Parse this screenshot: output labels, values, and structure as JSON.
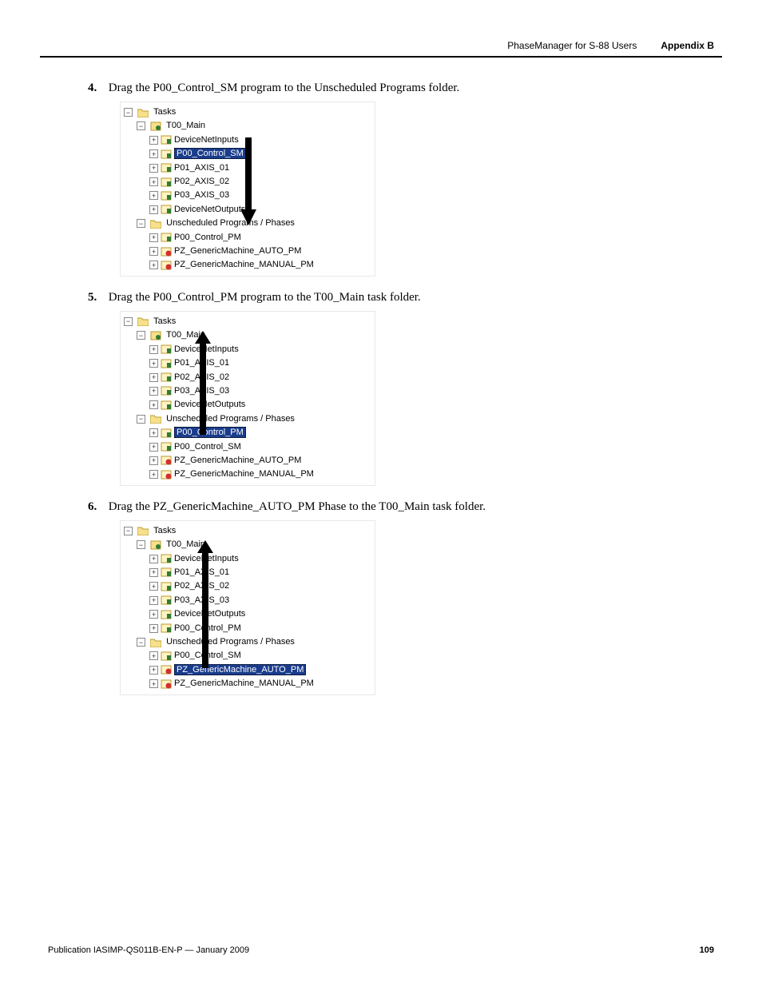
{
  "header": {
    "doc_title": "PhaseManager for S-88 Users",
    "section": "Appendix B"
  },
  "steps": {
    "s4": {
      "num": "4.",
      "text": "Drag the P00_Control_SM program to the Unscheduled Programs folder."
    },
    "s5": {
      "num": "5.",
      "text": "Drag the P00_Control_PM program to the T00_Main task folder."
    },
    "s6": {
      "num": "6.",
      "text": "Drag the PZ_GenericMachine_AUTO_PM Phase to the T00_Main task folder."
    }
  },
  "tree4": {
    "root": "Tasks",
    "main": "T00_Main",
    "items": {
      "i0": "DeviceNetInputs",
      "i1": "P00_Control_SM",
      "i2": "P01_AXIS_01",
      "i3": "P02_AXIS_02",
      "i4": "P03_AXIS_03",
      "i5": "DeviceNetOutputs"
    },
    "unsched": "Unscheduled Programs / Phases",
    "uitems": {
      "u0": "P00_Control_PM",
      "u1": "PZ_GenericMachine_AUTO_PM",
      "u2": "PZ_GenericMachine_MANUAL_PM"
    }
  },
  "tree5": {
    "root": "Tasks",
    "main": "T00_Main",
    "items": {
      "i0": "DeviceNetInputs",
      "i1": "P01_AXIS_01",
      "i2": "P02_AXIS_02",
      "i3": "P03_AXIS_03",
      "i4": "DeviceNetOutputs"
    },
    "unsched": "Unscheduled Programs / Phases",
    "uitems": {
      "u0": "P00_Control_PM",
      "u1": "P00_Control_SM",
      "u2": "PZ_GenericMachine_AUTO_PM",
      "u3": "PZ_GenericMachine_MANUAL_PM"
    }
  },
  "tree6": {
    "root": "Tasks",
    "main": "T00_Main",
    "items": {
      "i0": "DeviceNetInputs",
      "i1": "P01_AXIS_01",
      "i2": "P02_AXIS_02",
      "i3": "P03_AXIS_03",
      "i4": "DeviceNetOutputs",
      "i5": "P00_Control_PM"
    },
    "unsched": "Unscheduled Programs / Phases",
    "uitems": {
      "u0": "P00_Control_SM",
      "u1": "PZ_GenericMachine_AUTO_PM",
      "u2": "PZ_GenericMachine_MANUAL_PM"
    }
  },
  "exp": {
    "plus": "+",
    "minus": "−"
  },
  "footer": {
    "pub": "Publication IASIMP-QS011B-EN-P — January 2009",
    "page": "109"
  }
}
